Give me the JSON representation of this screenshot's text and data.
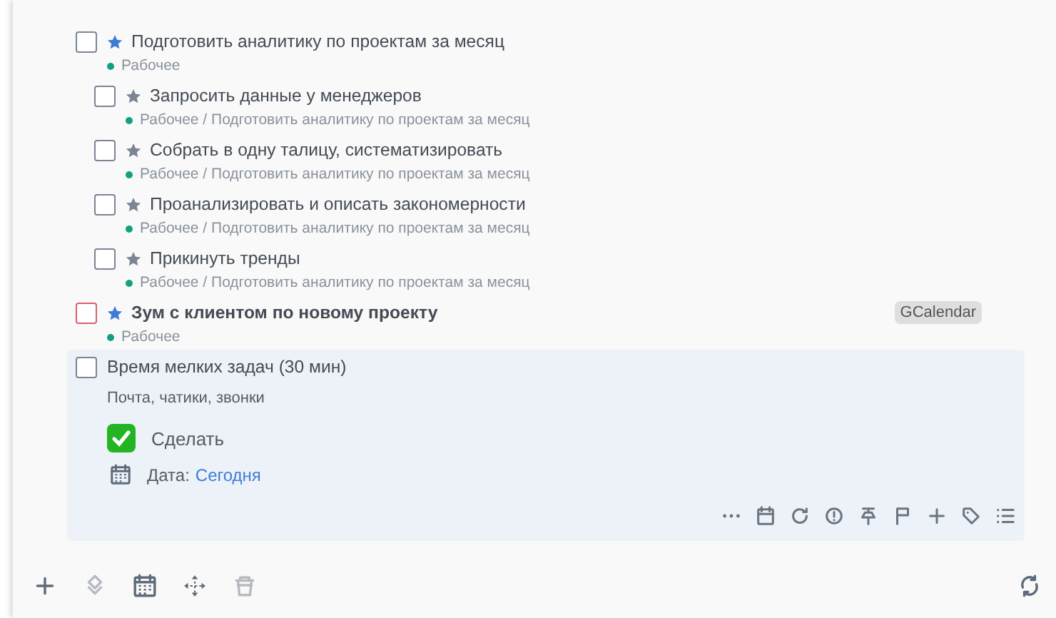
{
  "tasks": [
    {
      "title": "Подготовить аналитику по проектам за месяц",
      "starred": true,
      "important": false,
      "selected": false,
      "path": "Рабочее",
      "children": [
        {
          "title": "Запросить данные у менеджеров",
          "starred": false,
          "important": false,
          "selected": false,
          "path": "Рабочее / Подготовить аналитику по проектам за месяц"
        },
        {
          "title": "Собрать в одну талицу, систематизировать",
          "starred": false,
          "important": false,
          "selected": false,
          "path": "Рабочее / Подготовить аналитику по проектам за месяц"
        },
        {
          "title": "Проанализировать и описать закономерности",
          "starred": false,
          "important": false,
          "selected": false,
          "path": "Рабочее / Подготовить аналитику по проектам за месяц"
        },
        {
          "title": "Прикинуть тренды",
          "starred": false,
          "important": false,
          "selected": false,
          "path": "Рабочее / Подготовить аналитику по проектам за месяц"
        }
      ]
    },
    {
      "title": "Зум с клиентом по новому проекту",
      "starred": true,
      "important": true,
      "selected": false,
      "path": "Рабочее",
      "tag": "GCalendar"
    },
    {
      "title": "Время мелких задач (30 мин)",
      "important": false,
      "selected": true,
      "notes": "Почта, чатики, звонки",
      "checklist": [
        {
          "label": "Сделать",
          "checked": true
        }
      ],
      "date": {
        "label": "Дата:",
        "value": "Сегодня"
      },
      "actions": [
        {
          "kind": "more"
        },
        {
          "kind": "calendar"
        },
        {
          "kind": "repeat"
        },
        {
          "kind": "alert"
        },
        {
          "kind": "pin"
        },
        {
          "kind": "flag"
        },
        {
          "kind": "add"
        },
        {
          "kind": "tag"
        },
        {
          "kind": "list"
        }
      ]
    }
  ],
  "toolbar": [
    {
      "kind": "add",
      "disabled": false
    },
    {
      "kind": "layers",
      "disabled": true
    },
    {
      "kind": "calendar",
      "disabled": false
    },
    {
      "kind": "move",
      "disabled": false
    },
    {
      "kind": "trash",
      "disabled": true
    }
  ],
  "sync": {
    "kind": "sync"
  }
}
